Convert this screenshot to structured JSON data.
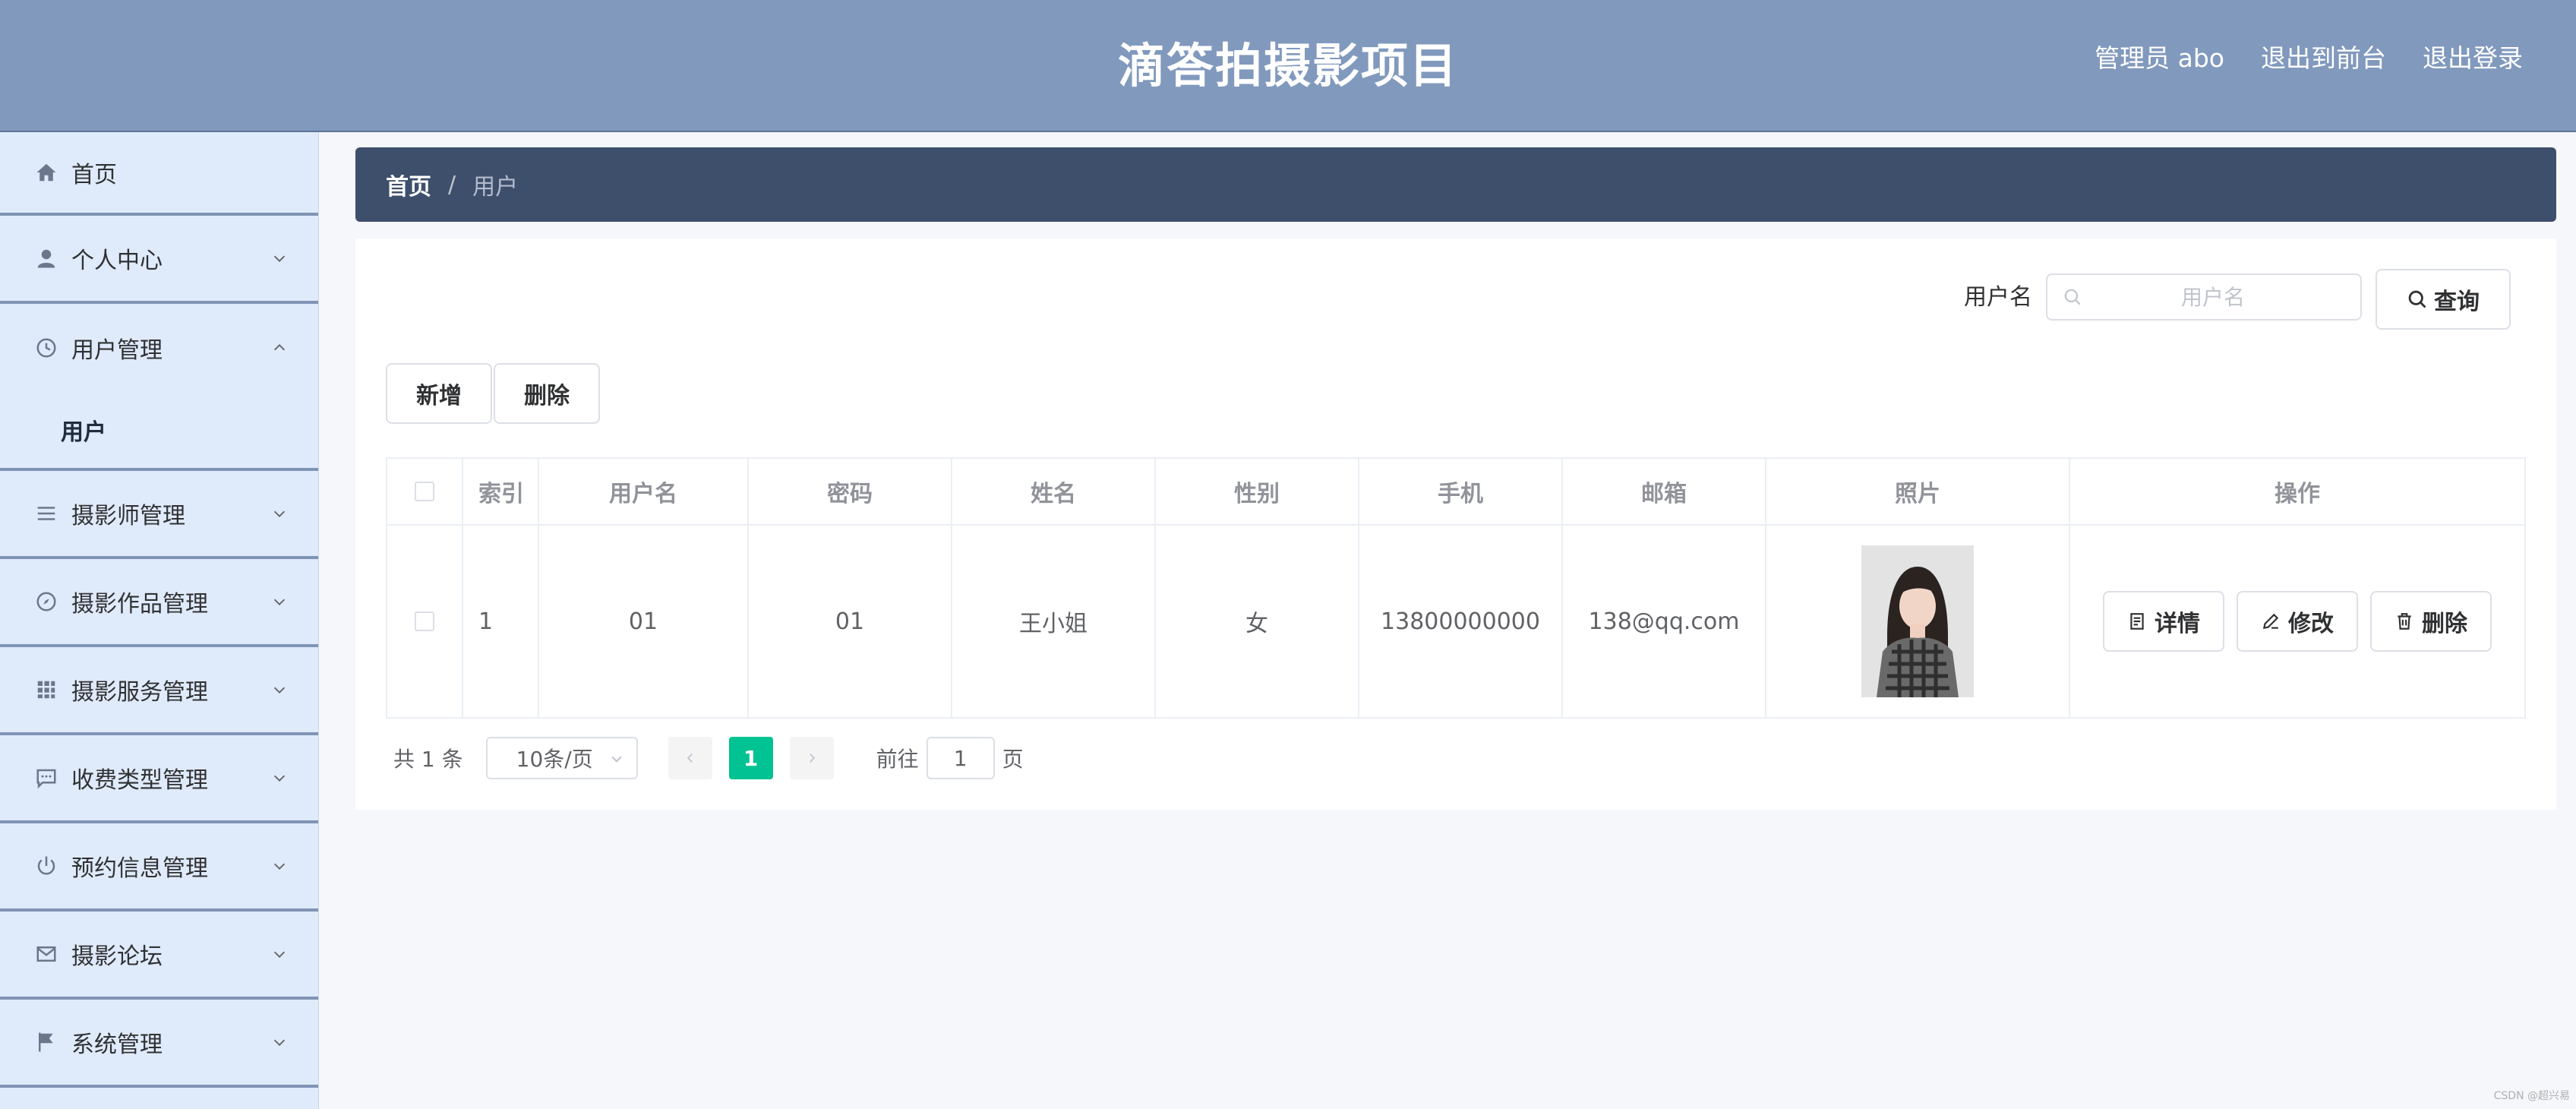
{
  "header": {
    "title": "滴答拍摄影项目",
    "admin_label": "管理员 abo",
    "to_front_label": "退出到前台",
    "logout_label": "退出登录",
    "bg_color": "#8199bd"
  },
  "sidebar": {
    "items": [
      {
        "label": "首页",
        "icon": "home-icon"
      },
      {
        "label": "个人中心",
        "icon": "user-icon"
      },
      {
        "label": "用户管理",
        "icon": "clock-icon",
        "expanded": true,
        "children": [
          {
            "label": "用户",
            "active": true
          }
        ]
      },
      {
        "label": "摄影师管理",
        "icon": "list-icon"
      },
      {
        "label": "摄影作品管理",
        "icon": "compass-icon"
      },
      {
        "label": "摄影服务管理",
        "icon": "grid-icon"
      },
      {
        "label": "收费类型管理",
        "icon": "chat-icon"
      },
      {
        "label": "预约信息管理",
        "icon": "power-icon"
      },
      {
        "label": "摄影论坛",
        "icon": "mail-icon"
      },
      {
        "label": "系统管理",
        "icon": "flag-icon"
      }
    ]
  },
  "breadcrumb": {
    "home": "首页",
    "separator": "/",
    "current": "用户"
  },
  "search": {
    "label": "用户名",
    "placeholder": "用户名",
    "value": "",
    "query_label": "查询"
  },
  "actions": {
    "add_label": "新增",
    "delete_label": "删除"
  },
  "table": {
    "columns": [
      "索引",
      "用户名",
      "密码",
      "姓名",
      "性别",
      "手机",
      "邮箱",
      "照片",
      "操作"
    ],
    "rows": [
      {
        "index": "1",
        "username": "01",
        "password": "01",
        "name": "王小姐",
        "gender": "女",
        "phone": "13800000000",
        "email": "138@qq.com",
        "detail_label": "详情",
        "edit_label": "修改",
        "delete_label": "删除"
      }
    ]
  },
  "pagination": {
    "total": "共 1 条",
    "page_size": "10条/页",
    "current_page": "1",
    "goto_label": "前往",
    "goto_value": "1",
    "page_suffix": "页",
    "active_color": "#00c292"
  },
  "watermark": "CSDN @超兴易"
}
